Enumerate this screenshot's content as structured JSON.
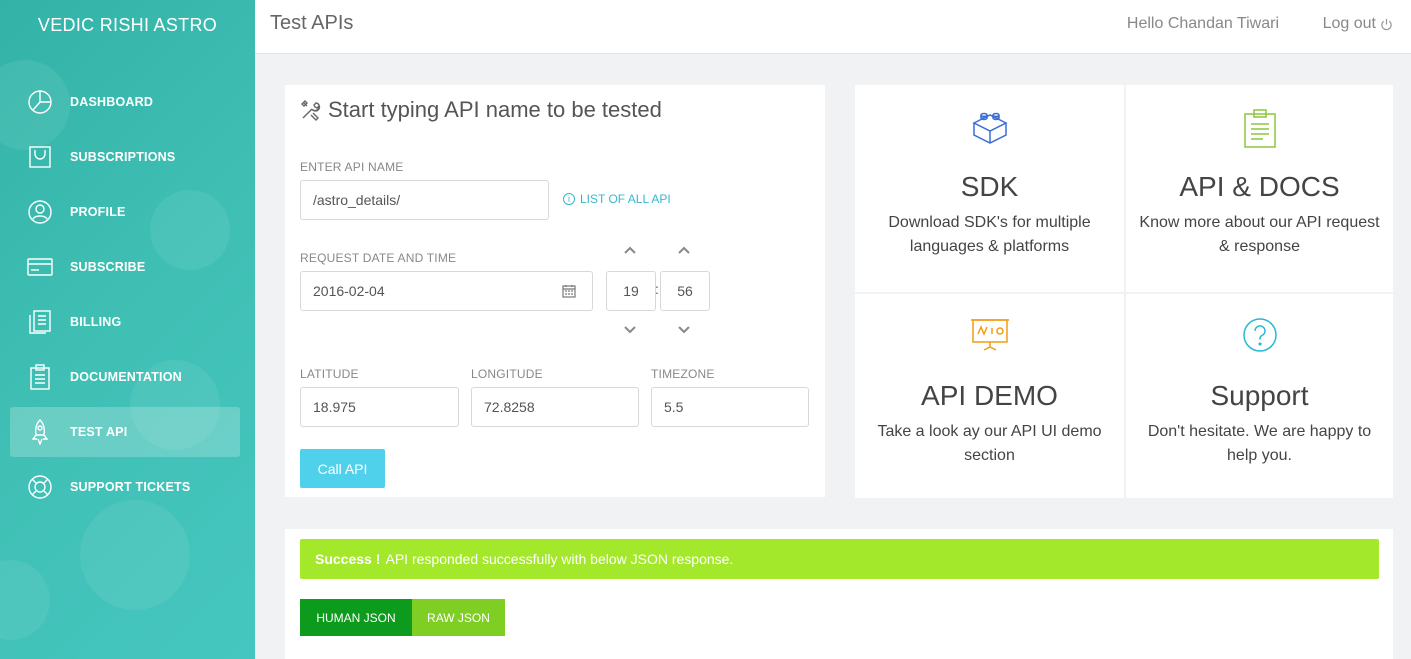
{
  "sidebar": {
    "brand": "VEDIC RISHI ASTRO",
    "items": [
      {
        "label": "DASHBOARD",
        "icon": "pie-chart-icon",
        "active": false
      },
      {
        "label": "SUBSCRIPTIONS",
        "icon": "cart-icon",
        "active": false
      },
      {
        "label": "PROFILE",
        "icon": "user-icon",
        "active": false
      },
      {
        "label": "SUBSCRIBE",
        "icon": "credit-card-icon",
        "active": false
      },
      {
        "label": "BILLING",
        "icon": "invoice-icon",
        "active": false
      },
      {
        "label": "DOCUMENTATION",
        "icon": "clipboard-icon",
        "active": false
      },
      {
        "label": "TEST API",
        "icon": "rocket-icon",
        "active": true
      },
      {
        "label": "SUPPORT TICKETS",
        "icon": "lifebuoy-icon",
        "active": false
      }
    ]
  },
  "topbar": {
    "title": "Test APIs",
    "greeting": "Hello Chandan Tiwari",
    "logout": "Log out"
  },
  "test_form": {
    "heading": "Start typing API name to be tested",
    "api_name_label": "ENTER API NAME",
    "api_name_value": "/astro_details/",
    "list_link": "LIST OF ALL API",
    "datetime_label": "REQUEST DATE AND TIME",
    "date_value": "2016-02-04",
    "hour": "19",
    "minute": "56",
    "time_separator": ":",
    "latitude_label": "LATITUDE",
    "latitude_value": "18.975",
    "longitude_label": "LONGITUDE",
    "longitude_value": "72.8258",
    "timezone_label": "TIMEZONE",
    "timezone_value": "5.5",
    "call_button": "Call API"
  },
  "cards": {
    "sdk": {
      "title": "SDK",
      "desc": "Download SDK's for multiple languages & platforms",
      "icon": "lego-block-icon"
    },
    "docs": {
      "title": "API & DOCS",
      "desc": "Know more about our API request & response",
      "icon": "clipboard-document-icon"
    },
    "demo": {
      "title": "API DEMO",
      "desc": "Take a look ay our API UI demo section",
      "icon": "presentation-board-icon"
    },
    "support": {
      "title": "Support",
      "desc": "Don't hesitate. We are happy to help you.",
      "icon": "question-circle-icon"
    }
  },
  "response": {
    "alert_strong": "Success !",
    "alert_text": "API responded successfully with below JSON response.",
    "tab_human": "HUMAN JSON",
    "tab_raw": "RAW JSON"
  },
  "colors": {
    "sidebar": "#3fbfb3",
    "call_button": "#4fd1ec",
    "success": "#a4e82c",
    "tab_human": "#0d9b1d",
    "tab_raw": "#7fce24",
    "sdk_icon": "#3a6fd8",
    "docs_icon": "#8cc63f",
    "demo_icon": "#f39c12",
    "support_icon": "#27b7d6"
  }
}
